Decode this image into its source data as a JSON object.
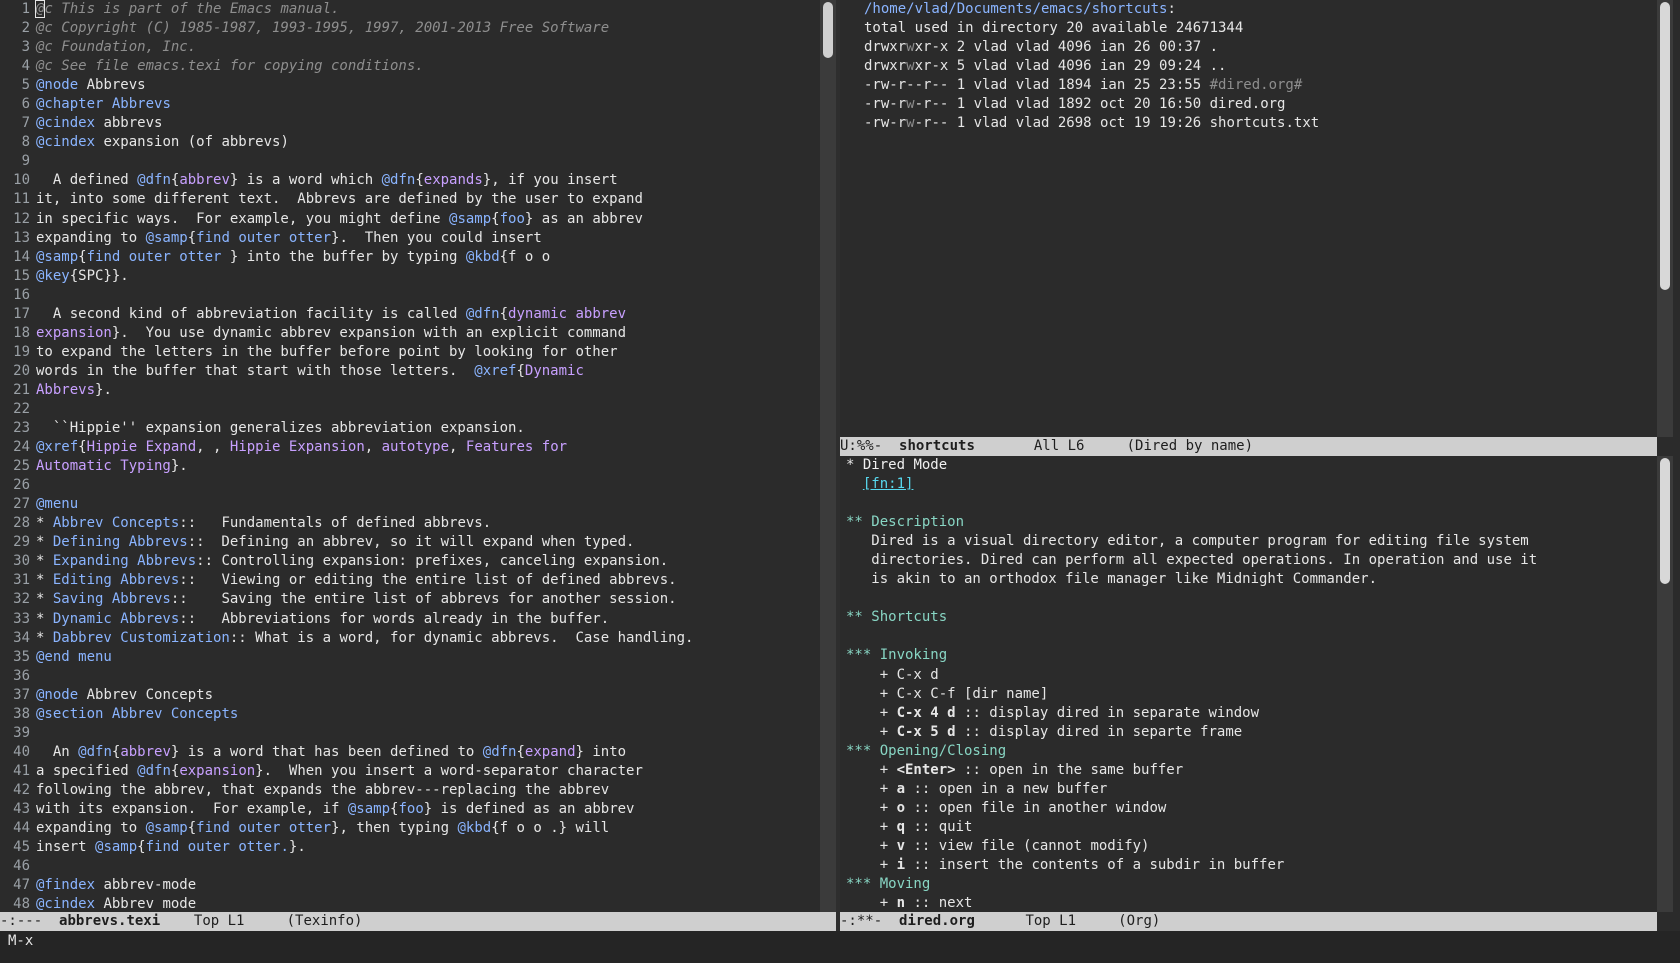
{
  "left_window": {
    "line_numbers": [
      "1",
      "2",
      "3",
      "4",
      "5",
      "6",
      "7",
      "8",
      "9",
      "10",
      "11",
      "12",
      "13",
      "14",
      "15",
      "16",
      "17",
      "18",
      "19",
      "20",
      "21",
      "22",
      "23",
      "24",
      "25",
      "26",
      "27",
      "28",
      "29",
      "30",
      "31",
      "32",
      "33",
      "34",
      "35",
      "36",
      "37",
      "38",
      "39",
      "40",
      "41",
      "42",
      "43",
      "44",
      "45",
      "46",
      "47",
      "48"
    ],
    "lines": [
      [
        {
          "t": "@c This is part of the Emacs manual.",
          "s": "com"
        }
      ],
      [
        {
          "t": "@c Copyright (C) 1985-1987, 1993-1995, 1997, 2001-2013 Free Software",
          "s": "com"
        }
      ],
      [
        {
          "t": "@c Foundation, Inc.",
          "s": "com"
        }
      ],
      [
        {
          "t": "@c See file emacs.texi for copying conditions.",
          "s": "com"
        }
      ],
      [
        {
          "t": "@node",
          "s": "kw"
        },
        {
          "t": " Abbrevs"
        }
      ],
      [
        {
          "t": "@chapter",
          "s": "kw"
        },
        {
          "t": " Abbrevs",
          "s": "kw"
        }
      ],
      [
        {
          "t": "@cindex",
          "s": "kw"
        },
        {
          "t": " abbrevs"
        }
      ],
      [
        {
          "t": "@cindex",
          "s": "kw"
        },
        {
          "t": " expansion (of abbrevs)"
        }
      ],
      [
        {
          "t": ""
        }
      ],
      [
        {
          "t": "  A defined "
        },
        {
          "t": "@dfn",
          "s": "kw"
        },
        {
          "t": "{"
        },
        {
          "t": "abbrev",
          "s": "arg"
        },
        {
          "t": "} is a word which "
        },
        {
          "t": "@dfn",
          "s": "kw"
        },
        {
          "t": "{"
        },
        {
          "t": "expands",
          "s": "arg"
        },
        {
          "t": "}, if you insert"
        }
      ],
      [
        {
          "t": "it, into some different text.  Abbrevs are defined by the user to expand"
        }
      ],
      [
        {
          "t": "in specific ways.  For example, you might define "
        },
        {
          "t": "@samp",
          "s": "kw"
        },
        {
          "t": "{"
        },
        {
          "t": "foo",
          "s": "kw"
        },
        {
          "t": "} as an abbrev"
        }
      ],
      [
        {
          "t": "expanding to "
        },
        {
          "t": "@samp",
          "s": "kw"
        },
        {
          "t": "{"
        },
        {
          "t": "find outer otter",
          "s": "kw"
        },
        {
          "t": "}.  Then you could insert"
        }
      ],
      [
        {
          "t": "@samp",
          "s": "kw"
        },
        {
          "t": "{"
        },
        {
          "t": "find outer otter ",
          "s": "kw"
        },
        {
          "t": "} into the buffer by typing "
        },
        {
          "t": "@kbd",
          "s": "kw"
        },
        {
          "t": "{f o o"
        }
      ],
      [
        {
          "t": "@key",
          "s": "kw"
        },
        {
          "t": "{SPC}}."
        }
      ],
      [
        {
          "t": ""
        }
      ],
      [
        {
          "t": "  A second kind of abbreviation facility is called "
        },
        {
          "t": "@dfn",
          "s": "kw"
        },
        {
          "t": "{"
        },
        {
          "t": "dynamic abbrev",
          "s": "arg"
        }
      ],
      [
        {
          "t": "expansion",
          "s": "arg"
        },
        {
          "t": "}.  You use dynamic abbrev expansion with an explicit command"
        }
      ],
      [
        {
          "t": "to expand the letters in the buffer before point by looking for other"
        }
      ],
      [
        {
          "t": "words in the buffer that start with those letters.  "
        },
        {
          "t": "@xref",
          "s": "kw"
        },
        {
          "t": "{"
        },
        {
          "t": "Dynamic",
          "s": "arg"
        }
      ],
      [
        {
          "t": "Abbrevs",
          "s": "arg"
        },
        {
          "t": "}."
        }
      ],
      [
        {
          "t": ""
        }
      ],
      [
        {
          "t": "  ``Hippie'' expansion generalizes abbreviation expansion."
        }
      ],
      [
        {
          "t": "@xref",
          "s": "kw"
        },
        {
          "t": "{"
        },
        {
          "t": "Hippie Expand",
          "s": "arg"
        },
        {
          "t": ", , "
        },
        {
          "t": "Hippie Expansion",
          "s": "arg"
        },
        {
          "t": ", "
        },
        {
          "t": "autotype",
          "s": "arg"
        },
        {
          "t": ", "
        },
        {
          "t": "Features for",
          "s": "arg"
        }
      ],
      [
        {
          "t": "Automatic Typing",
          "s": "arg"
        },
        {
          "t": "}."
        }
      ],
      [
        {
          "t": ""
        }
      ],
      [
        {
          "t": "@menu",
          "s": "kw"
        }
      ],
      [
        {
          "t": "* "
        },
        {
          "t": "Abbrev Concepts",
          "s": "kw"
        },
        {
          "t": "::   Fundamentals of defined abbrevs."
        }
      ],
      [
        {
          "t": "* "
        },
        {
          "t": "Defining Abbrevs",
          "s": "kw"
        },
        {
          "t": "::  Defining an abbrev, so it will expand when typed."
        }
      ],
      [
        {
          "t": "* "
        },
        {
          "t": "Expanding Abbrevs",
          "s": "kw"
        },
        {
          "t": ":: Controlling expansion: prefixes, canceling expansion."
        }
      ],
      [
        {
          "t": "* "
        },
        {
          "t": "Editing Abbrevs",
          "s": "kw"
        },
        {
          "t": "::   Viewing or editing the entire list of defined abbrevs."
        }
      ],
      [
        {
          "t": "* "
        },
        {
          "t": "Saving Abbrevs",
          "s": "kw"
        },
        {
          "t": "::    Saving the entire list of abbrevs for another session."
        }
      ],
      [
        {
          "t": "* "
        },
        {
          "t": "Dynamic Abbrevs",
          "s": "kw"
        },
        {
          "t": "::   Abbreviations for words already in the buffer."
        }
      ],
      [
        {
          "t": "* "
        },
        {
          "t": "Dabbrev Customization",
          "s": "kw"
        },
        {
          "t": ":: What is a word, for dynamic abbrevs.  Case handling."
        }
      ],
      [
        {
          "t": "@end menu",
          "s": "kw"
        }
      ],
      [
        {
          "t": ""
        }
      ],
      [
        {
          "t": "@node",
          "s": "kw"
        },
        {
          "t": " Abbrev Concepts"
        }
      ],
      [
        {
          "t": "@section",
          "s": "kw"
        },
        {
          "t": " Abbrev Concepts",
          "s": "kw"
        }
      ],
      [
        {
          "t": ""
        }
      ],
      [
        {
          "t": "  An "
        },
        {
          "t": "@dfn",
          "s": "kw"
        },
        {
          "t": "{"
        },
        {
          "t": "abbrev",
          "s": "arg"
        },
        {
          "t": "} is a word that has been defined to "
        },
        {
          "t": "@dfn",
          "s": "kw"
        },
        {
          "t": "{"
        },
        {
          "t": "expand",
          "s": "arg"
        },
        {
          "t": "} into"
        }
      ],
      [
        {
          "t": "a specified "
        },
        {
          "t": "@dfn",
          "s": "kw"
        },
        {
          "t": "{"
        },
        {
          "t": "expansion",
          "s": "arg"
        },
        {
          "t": "}.  When you insert a word-separator character"
        }
      ],
      [
        {
          "t": "following the abbrev, that expands the abbrev---replacing the abbrev"
        }
      ],
      [
        {
          "t": "with its expansion.  For example, if "
        },
        {
          "t": "@samp",
          "s": "kw"
        },
        {
          "t": "{"
        },
        {
          "t": "foo",
          "s": "kw"
        },
        {
          "t": "} is defined as an abbrev"
        }
      ],
      [
        {
          "t": "expanding to "
        },
        {
          "t": "@samp",
          "s": "kw"
        },
        {
          "t": "{"
        },
        {
          "t": "find outer otter",
          "s": "kw"
        },
        {
          "t": "}, then typing "
        },
        {
          "t": "@kbd",
          "s": "kw"
        },
        {
          "t": "{f o o .} will"
        }
      ],
      [
        {
          "t": "insert "
        },
        {
          "t": "@samp",
          "s": "kw"
        },
        {
          "t": "{"
        },
        {
          "t": "find outer otter.",
          "s": "kw"
        },
        {
          "t": "}."
        }
      ],
      [
        {
          "t": ""
        }
      ],
      [
        {
          "t": "@findex",
          "s": "kw"
        },
        {
          "t": " abbrev-mode"
        }
      ],
      [
        {
          "t": "@cindex",
          "s": "kw"
        },
        {
          "t": " Abbrev mode"
        }
      ]
    ],
    "modeline": {
      "status": "-:---  ",
      "buffer": "abbrevs.texi",
      "position": "    Top L1     ",
      "mode": "(Texinfo)"
    }
  },
  "right_top_window": {
    "lines": [
      [
        {
          "t": "/home/vlad/Documents/emacs/shortcuts",
          "s": "path"
        },
        {
          "t": ":"
        }
      ],
      [
        {
          "t": "total used in directory 20 available 24671344"
        }
      ],
      [
        {
          "t": "drwxr"
        },
        {
          "t": "w",
          "s": "dim"
        },
        {
          "t": "xr-x 2 vlad vlad 4096 ian 26 00:37 ."
        }
      ],
      [
        {
          "t": "drwxr"
        },
        {
          "t": "w",
          "s": "dim"
        },
        {
          "t": "xr-x 5 vlad vlad 4096 ian 29 09:24 .."
        }
      ],
      [
        {
          "t": "-rw-r--r-- 1 vlad vlad 1894 ian 25 23:55 "
        },
        {
          "t": "#dired.org#",
          "s": "dim"
        }
      ],
      [
        {
          "t": "-rw-r"
        },
        {
          "t": "w",
          "s": "dim"
        },
        {
          "t": "-r-- 1 vlad vlad 1892 oct 20 16:50 "
        },
        {
          "t": "d",
          "s": "cursor"
        },
        {
          "t": "ired.org"
        }
      ],
      [
        {
          "t": "-rw-r"
        },
        {
          "t": "w",
          "s": "dim"
        },
        {
          "t": "-r-- 1 vlad vlad 2698 oct 19 19:26 shortcuts.txt"
        }
      ]
    ],
    "modeline": {
      "status": "U:%%-  ",
      "buffer": "shortcuts",
      "position": "       All L6     ",
      "mode": "(Dired by name)"
    }
  },
  "right_bottom_window": {
    "lines": [
      [
        {
          "t": "*",
          "s": "cursor"
        },
        {
          "t": " Dired Mode",
          "s": "bul"
        }
      ],
      [
        {
          "t": "  "
        },
        {
          "t": "[fn:1]",
          "s": "link"
        }
      ],
      [
        {
          "t": ""
        }
      ],
      [
        {
          "t": "** Description",
          "s": "head"
        }
      ],
      [
        {
          "t": "   Dired is a visual directory editor, a computer program for editing file system"
        }
      ],
      [
        {
          "t": "   directories. Dired can perform all expected operations. In operation and use it"
        }
      ],
      [
        {
          "t": "   is akin to an orthodox file manager like Midnight Commander."
        }
      ],
      [
        {
          "t": ""
        }
      ],
      [
        {
          "t": "** Shortcuts",
          "s": "head"
        }
      ],
      [
        {
          "t": ""
        }
      ],
      [
        {
          "t": "*** Invoking",
          "s": "head"
        }
      ],
      [
        {
          "t": "    + C-x d"
        }
      ],
      [
        {
          "t": "    + C-x C-f [dir name]"
        }
      ],
      [
        {
          "t": "    + "
        },
        {
          "t": "C-x 4 d",
          "s": "bold"
        },
        {
          "t": " :: display dired in separate window"
        }
      ],
      [
        {
          "t": "    + "
        },
        {
          "t": "C-x 5 d",
          "s": "bold"
        },
        {
          "t": " :: display dired in separte frame"
        }
      ],
      [
        {
          "t": "*** Opening/Closing",
          "s": "head"
        }
      ],
      [
        {
          "t": "    + "
        },
        {
          "t": "<Enter>",
          "s": "bold"
        },
        {
          "t": " :: open in the same buffer"
        }
      ],
      [
        {
          "t": "    + "
        },
        {
          "t": "a",
          "s": "bold"
        },
        {
          "t": " :: open in a new buffer"
        }
      ],
      [
        {
          "t": "    + "
        },
        {
          "t": "o",
          "s": "bold"
        },
        {
          "t": " :: open file in another window"
        }
      ],
      [
        {
          "t": "    + "
        },
        {
          "t": "q",
          "s": "bold"
        },
        {
          "t": " :: quit"
        }
      ],
      [
        {
          "t": "    + "
        },
        {
          "t": "v",
          "s": "bold"
        },
        {
          "t": " :: view file (cannot modify)"
        }
      ],
      [
        {
          "t": "    + "
        },
        {
          "t": "i",
          "s": "bold"
        },
        {
          "t": " :: insert the contents of a subdir in buffer"
        }
      ],
      [
        {
          "t": "*** Moving",
          "s": "head"
        }
      ],
      [
        {
          "t": "    + "
        },
        {
          "t": "n",
          "s": "bold"
        },
        {
          "t": " :: next"
        }
      ]
    ],
    "modeline": {
      "status": "-:**-  ",
      "buffer": "dired.org",
      "position": "      Top L1     ",
      "mode": "(Org)"
    }
  },
  "echo_area": {
    "text": "M-x"
  }
}
